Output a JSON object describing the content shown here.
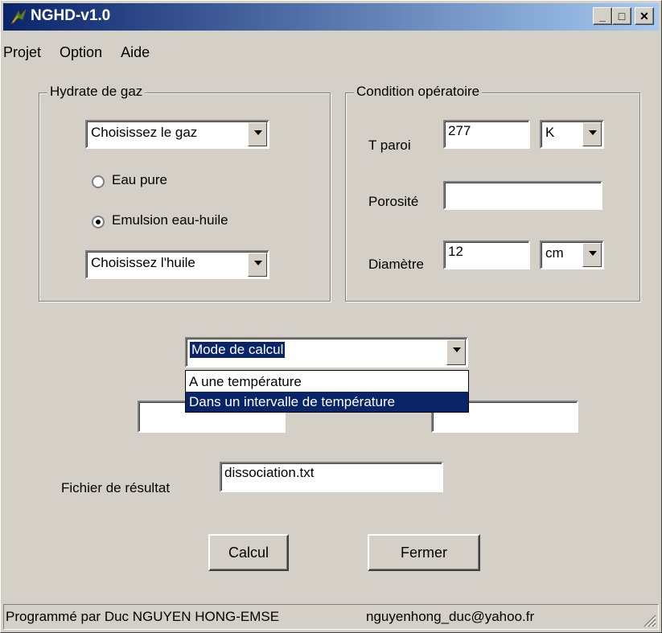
{
  "window": {
    "title": "NGHD-v1.0",
    "icon": "app-leaf-icon",
    "min_glyph": "_",
    "max_glyph": "□",
    "close_glyph": "✕"
  },
  "menu": {
    "items": [
      "Projet",
      "Option",
      "Aide"
    ]
  },
  "hydrate_group": {
    "title": "Hydrate de gaz",
    "gas_select": "Choisissez le gaz",
    "radio_pure": "Eau pure",
    "radio_emulsion": "Emulsion eau-huile",
    "selected_radio": "Emulsion eau-huile",
    "oil_select": "Choisissez l'huile"
  },
  "condition_group": {
    "title": "Condition opératoire",
    "t_label": "T paroi",
    "t_value": "277",
    "t_unit": "K",
    "porosity_label": "Porosité",
    "porosity_value": "",
    "diameter_label": "Diamètre",
    "diameter_value": "12",
    "diameter_unit": "cm"
  },
  "mode": {
    "selected": "Mode de calcul",
    "options": [
      "A une température",
      "Dans un intervalle de température"
    ],
    "highlighted": "Dans un intervalle de température"
  },
  "range_inputs": {
    "left": "",
    "right": ""
  },
  "result": {
    "label": "Fichier de résultat",
    "value": "dissociation.txt"
  },
  "buttons": {
    "calc": "Calcul",
    "close": "Fermer"
  },
  "status": {
    "author": "Programmé par Duc NGUYEN HONG-EMSE",
    "email": "nguyenhong_duc@yahoo.fr"
  },
  "colors": {
    "title_start": "#0a246a",
    "title_end": "#a6caf0",
    "highlight": "#0a246a",
    "face": "#d4d0c8"
  }
}
